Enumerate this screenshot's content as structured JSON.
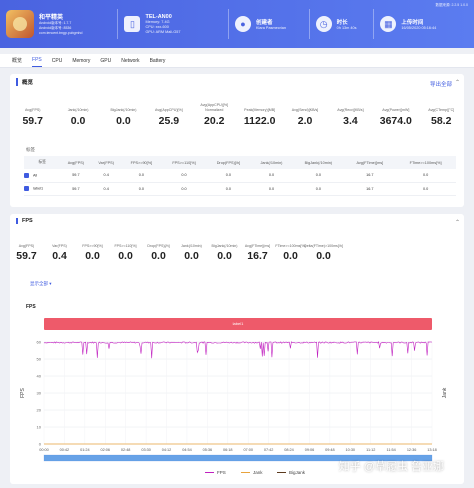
{
  "header": {
    "game": {
      "name": "和平精英",
      "line1": "Android版本号: 1.7.7",
      "line2": "Android版本号: 8536",
      "line3": "com.tencent.tmgp.pubgmhd"
    },
    "device": {
      "name": "TEL-AN00",
      "memory": "Memory: 7.4G",
      "cpu": "CPU: xxx-600",
      "gpu": "GPU: ARM Mali-G57"
    },
    "tester": {
      "title": "创建者",
      "name": "Klara Pasmecrian"
    },
    "duration": {
      "title": "时长",
      "value": "0h 13m 40s"
    },
    "upload": {
      "title": "上传时间",
      "value": "16/05/2020 05:16:44"
    },
    "note": "数据来源: 2.2.5 1.0.0"
  },
  "tabs": [
    "概览",
    "FPS",
    "CPU",
    "Memory",
    "GPU",
    "Network",
    "Battery"
  ],
  "overview": {
    "title": "概览",
    "export_label": "导出全部",
    "stats": [
      {
        "label": "Avg(FPS)",
        "value": "59.7"
      },
      {
        "label": "Jank(/10min)",
        "value": "0.0"
      },
      {
        "label": "BigJank(/10min)",
        "value": "0.0"
      },
      {
        "label": "Avg(AppCPU)[%]",
        "value": "25.9"
      },
      {
        "label": "Avg(AppCPU)[%] Normalized",
        "value": "20.2"
      },
      {
        "label": "Peak(Memory)[MB]",
        "value": "1122.0"
      },
      {
        "label": "Avg(Send)[KB/s]",
        "value": "2.0"
      },
      {
        "label": "Avg(Recv)[KB/s]",
        "value": "3.4"
      },
      {
        "label": "Avg(Power)[mW]",
        "value": "3674.0"
      },
      {
        "label": "Avg(CTemp)[°C]",
        "value": "58.2"
      }
    ],
    "label_title": "标签",
    "table": {
      "headers": [
        "标签",
        "Avg(FPS)",
        "Var(FPS)",
        "FPS>=90[%]",
        "FPS>=110[%]",
        "Drop(FPS)[/h]",
        "Jank(/10min)",
        "BigJank(/10min)",
        "Avg(FTime)[ms]",
        "FTime>=100ms[%]"
      ],
      "rows": [
        [
          "All",
          "59.7",
          "0.4",
          "0.0",
          "0.0",
          "0.0",
          "0.0",
          "0.0",
          "16.7",
          "0.0"
        ],
        [
          "label1",
          "59.7",
          "0.4",
          "0.0",
          "0.0",
          "0.0",
          "0.0",
          "0.0",
          "16.7",
          "0.0"
        ]
      ]
    }
  },
  "fps_section": {
    "title": "FPS",
    "stats": [
      {
        "label": "Avg(FPS)",
        "value": "59.7"
      },
      {
        "label": "Var(FPS)",
        "value": "0.4"
      },
      {
        "label": "FPS>=90[%]",
        "value": "0.0"
      },
      {
        "label": "FPS>=110[%]",
        "value": "0.0"
      },
      {
        "label": "Drop(FPS)[/h]",
        "value": "0.0"
      },
      {
        "label": "Jank(/10min)",
        "value": "0.0"
      },
      {
        "label": "BigJank(/10min)",
        "value": "0.0"
      },
      {
        "label": "Avg(FTime)[ms]",
        "value": "16.7"
      },
      {
        "label": "FTime>=100ms[%]",
        "value": "0.0"
      },
      {
        "label": "Delta(FTime)>100ms[/h]",
        "value": "0.0"
      }
    ],
    "show_all": "显示全部 ▾",
    "chart_title": "FPS",
    "label_bar": "label1"
  },
  "chart_data": {
    "type": "line",
    "title": "FPS",
    "ylabel": "FPS",
    "ylabel_right": "Jank",
    "ylim": [
      0,
      60
    ],
    "yticks": [
      0,
      10,
      20,
      30,
      40,
      50,
      60
    ],
    "x_ticks": [
      "00:00",
      "00:42",
      "01:24",
      "02:06",
      "02:48",
      "03:30",
      "04:12",
      "04:54",
      "05:36",
      "06:18",
      "07:00",
      "07:42",
      "08:24",
      "09:06",
      "09:48",
      "10:30",
      "11:12",
      "11:54",
      "12:36",
      "13:18"
    ],
    "series": [
      {
        "name": "FPS",
        "color": "#c020c0",
        "typical": 59.7,
        "range": [
          50,
          60
        ]
      },
      {
        "name": "Jank",
        "color": "#e8a33c",
        "values": [
          0
        ]
      },
      {
        "name": "BigJank",
        "color": "#5c3a1e",
        "values": [
          0
        ]
      }
    ],
    "grid": true,
    "legend": "bottom"
  },
  "watermark": "知乎 @草履虫 鲁亚娜"
}
